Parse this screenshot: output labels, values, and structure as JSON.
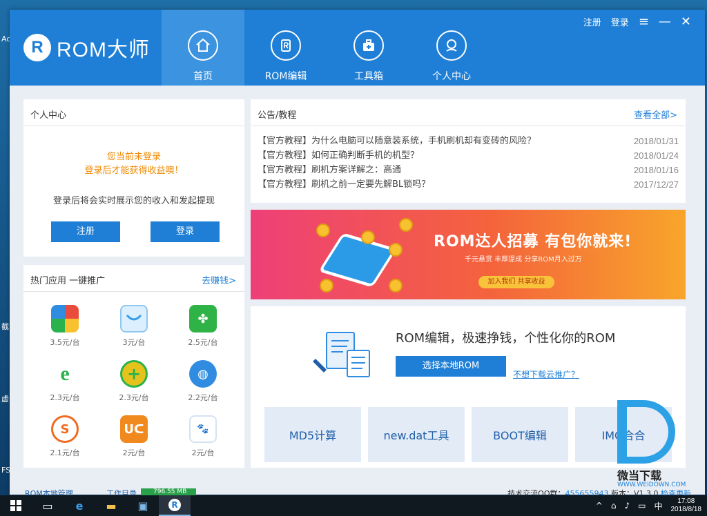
{
  "desktop": {
    "labels": [
      "Ac",
      "截",
      "虚",
      "FS"
    ]
  },
  "app": {
    "logo_text": "ROM大师",
    "nav": [
      {
        "label": "首页",
        "icon": "home-icon"
      },
      {
        "label": "ROM编辑",
        "icon": "rom-edit-icon"
      },
      {
        "label": "工具箱",
        "icon": "toolbox-icon"
      },
      {
        "label": "个人中心",
        "icon": "user-icon"
      }
    ],
    "window": {
      "register": "注册",
      "login": "登录",
      "menu": "≡",
      "minimize": "—",
      "close": "✕"
    }
  },
  "personal": {
    "title": "个人中心",
    "warn1": "您当前未登录",
    "warn2": "登录后才能获得收益噢！",
    "info": "登录后将会实时展示您的收入和发起提现",
    "register": "注册",
    "login": "登录"
  },
  "hot_apps": {
    "title": "热门应用 一键推广",
    "link": "去赚钱>",
    "items": [
      {
        "price": "3.5元/台",
        "icon": "pinwheel-app-icon",
        "color": "#f2a52a"
      },
      {
        "price": "3元/台",
        "icon": "app-store-icon",
        "color": "#8fc7ef"
      },
      {
        "price": "2.5元/台",
        "icon": "clover-app-icon",
        "color": "#2fb347"
      },
      {
        "price": "2.3元/台",
        "icon": "browser-e-icon",
        "color": "#2bb24c"
      },
      {
        "price": "2.3元/台",
        "icon": "security-plus-icon",
        "color": "#e6c21d"
      },
      {
        "price": "2.2元/台",
        "icon": "globe-browser-icon",
        "color": "#2f8ce0"
      },
      {
        "price": "2.1元/台",
        "icon": "s-app-icon",
        "color": "#f06a1f"
      },
      {
        "price": "2元/台",
        "icon": "uc-browser-icon",
        "color": "#f08a1f"
      },
      {
        "price": "2元/台",
        "icon": "baidu-icon",
        "color": "#2d6fd6"
      }
    ]
  },
  "notices": {
    "title": "公告/教程",
    "link": "查看全部>",
    "items": [
      {
        "text": "【官方教程】为什么电脑可以随意装系统，手机刷机却有变砖的风险？",
        "date": "2018/01/31"
      },
      {
        "text": "【官方教程】如何正确判断手机的机型？",
        "date": "2018/01/24"
      },
      {
        "text": "【官方教程】刷机方案详解之：高通",
        "date": "2018/01/16"
      },
      {
        "text": "【官方教程】刷机之前一定要先解BL锁吗？",
        "date": "2017/12/27"
      }
    ]
  },
  "banner": {
    "title": "ROM达人招募 有包你就来!",
    "sub": "千元悬赏  丰厚提成  分享ROM月入过万",
    "cta": "加入我们 共享收益"
  },
  "rom_edit": {
    "slogan": "ROM编辑，极速挣钱，个性化你的ROM",
    "primary": "选择本地ROM",
    "link": "不想下载云推广？",
    "tools": [
      "MD5计算",
      "new.dat工具",
      "BOOT编辑",
      "IMG合合"
    ]
  },
  "status": {
    "left": "ROM本地管理",
    "path": "工作目录",
    "size": "796.55 MB",
    "right_prefix": "技术交流QQ群：",
    "qq": "455655943",
    "version": "  版本：V1.3.0",
    "check": "检查更新"
  },
  "watermark": {
    "text": "微当下载",
    "url": "WWW.WEIDOWN.COM"
  },
  "taskbar": {
    "time": "17:08",
    "date": "2018/8/18",
    "lang": "中"
  },
  "colors": {
    "brand": "#1f7fd6",
    "warn": "#f08a00"
  }
}
